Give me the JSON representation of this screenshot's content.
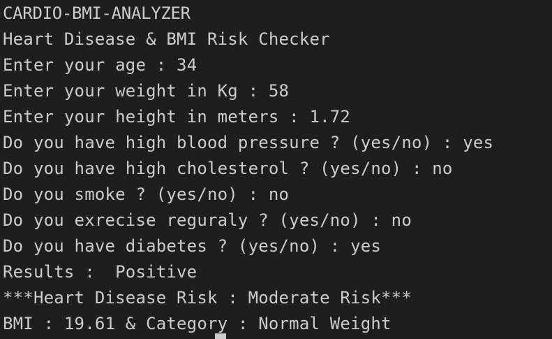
{
  "terminal": {
    "lines": [
      "CARDIO-BMI-ANALYZER",
      "Heart Disease & BMI Risk Checker",
      "Enter your age : 34",
      "Enter your weight in Kg : 58",
      "Enter your height in meters : 1.72",
      "Do you have high blood pressure ? (yes/no) : yes",
      "Do you have high cholesterol ? (yes/no) : no",
      "Do you smoke ? (yes/no) : no",
      "Do you exrecise reguraly ? (yes/no) : no",
      "Do you have diabetes ? (yes/no) : yes",
      "Results :  Positive",
      "***Heart Disease Risk : Moderate Risk***",
      "BMI : 19.61 & Category : Normal Weight"
    ]
  },
  "colors": {
    "background": "#1e1e1e",
    "foreground": "#cccccc"
  }
}
